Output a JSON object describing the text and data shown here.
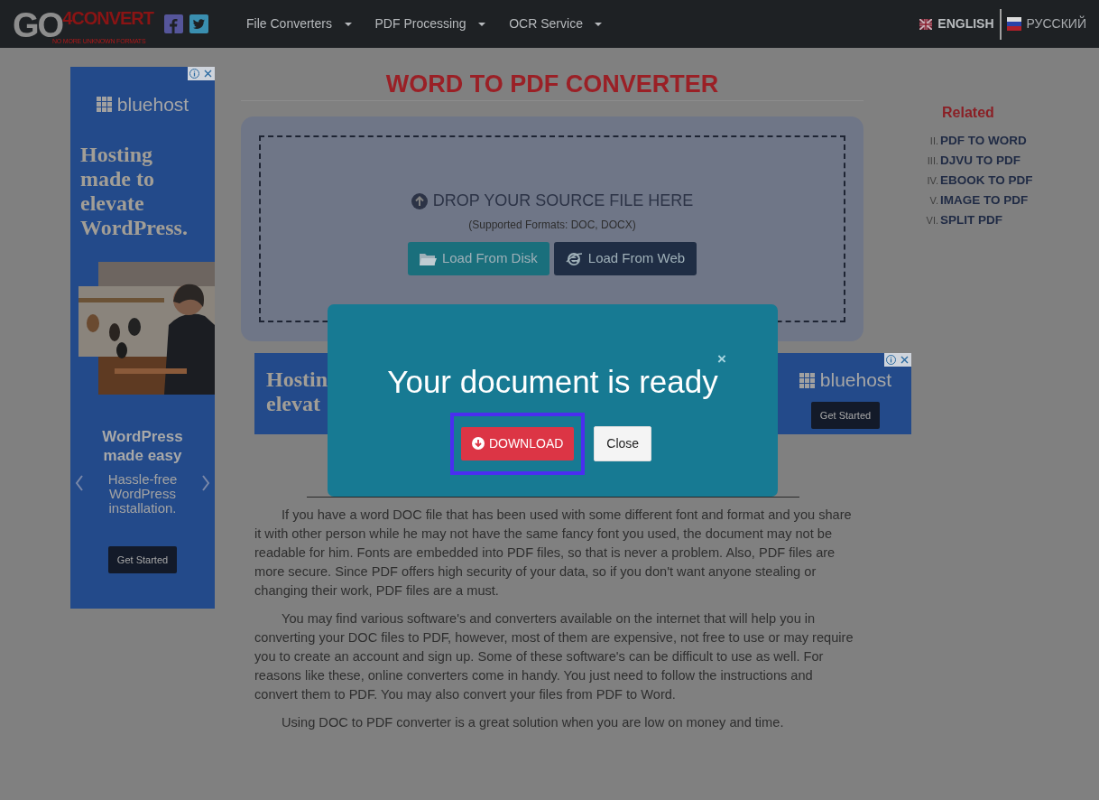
{
  "navbar": {
    "logo": {
      "part_1": "GO",
      "part_2": "4CONVERT",
      "tagline": "NO MORE UNKNOWN FORMATS"
    },
    "social": [
      {
        "kind": "facebook"
      },
      {
        "kind": "twitter"
      }
    ],
    "menu": [
      {
        "label": "File Converters"
      },
      {
        "label": "PDF Processing"
      },
      {
        "label": "OCR Service"
      }
    ],
    "languages": [
      {
        "label": "ENGLISH",
        "kind": "uk",
        "selected": true
      },
      {
        "label": "РУССКИЙ",
        "kind": "ru",
        "selected": false
      }
    ]
  },
  "side_ad": {
    "brand": "bluehost",
    "headline": "Hosting made to elevate WordPress.",
    "slide_title": "WordPress made easy",
    "slide_text": "Hassle-free WordPress installation.",
    "button": "Get Started"
  },
  "converter": {
    "title": "WORD TO PDF CONVERTER",
    "drop_text": "DROP YOUR SOURCE FILE HERE",
    "formats": "(Supported Formats: DOC, DOCX)",
    "buttons": [
      {
        "label": "Load From Disk",
        "kind": "disk"
      },
      {
        "label": "Load From Web",
        "kind": "web"
      }
    ]
  },
  "banner_ad": {
    "headline_lines": [
      "Hostin",
      "elevat"
    ],
    "brand": "bluehost",
    "button": "Get Started"
  },
  "related": {
    "title": "Related",
    "items": [
      {
        "number": "II.",
        "label": "PDF TO WORD"
      },
      {
        "number": "III.",
        "label": "DJVU TO PDF"
      },
      {
        "number": "IV.",
        "label": "EBOOK TO PDF"
      },
      {
        "number": "V.",
        "label": "IMAGE TO PDF"
      },
      {
        "number": "VI.",
        "label": "SPLIT PDF"
      }
    ]
  },
  "article": {
    "paragraphs": [
      "If you have a word DOC file that has been used with some different font and format and you share it with other person while he may not have the same fancy font you used, the document may not be readable for him. Fonts are embedded into PDF files, so that is never a problem. Also, PDF files are more secure. Since PDF offers high security of your data, so if you don't want anyone stealing or changing their work, PDF files are a must.",
      "You may find various software's and converters available on the internet that will help you in converting your DOC files to PDF, however, most of them are expensive, not free to use or may require you to create an account and sign up. Some of these software's can be difficult to use as well. For reasons like these, online converters come in handy. You just need to follow the instructions and convert them to PDF. You may also convert your files from PDF to Word.",
      "Using DOC to PDF converter is a great solution when you are low on money and time."
    ]
  },
  "modal": {
    "title": "Your document is ready",
    "close_glyph": "×",
    "buttons": [
      {
        "label": "DOWNLOAD",
        "kind": "download",
        "highlighted": true
      },
      {
        "label": "Close",
        "kind": "close",
        "highlighted": false
      }
    ]
  }
}
